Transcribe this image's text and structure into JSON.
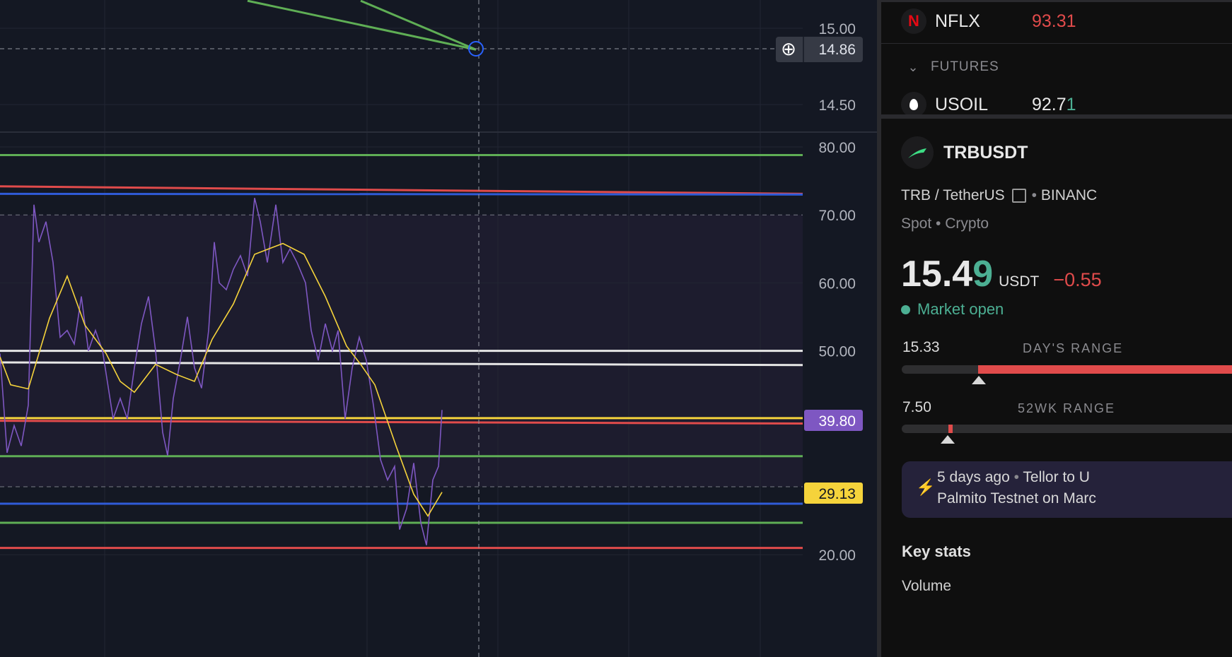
{
  "watchlist": {
    "items": [
      {
        "symbol": "NFLX",
        "price": "93.31",
        "logo": "N"
      }
    ],
    "section": "FUTURES",
    "futures": [
      {
        "symbol": "USOIL",
        "price_main": "92.7",
        "price_tick": "1"
      }
    ]
  },
  "symbol": {
    "ticker": "TRBUSDT",
    "description": "TRB / TetherUS",
    "exchange": "BINANC",
    "type": "Spot",
    "category": "Crypto",
    "price_main": "15.4",
    "price_tick": "9",
    "currency": "USDT",
    "change": "−0.55",
    "status": "Market open",
    "day_low": "15.33",
    "day_label": "DAY'S RANGE",
    "wk_low": "7.50",
    "wk_label": "52WK RANGE",
    "news_time": "5 days ago",
    "news_line1": "Tellor to U",
    "news_line2": "Palmito Testnet on Marc",
    "key_stats": "Key stats",
    "volume": "Volume"
  },
  "colors": {
    "up": "#4caf93",
    "down": "#e04b4b",
    "rsi": "#7e57c2",
    "ma": "#f5d33b"
  },
  "chart_data": [
    {
      "type": "line",
      "pane": "price",
      "yticks": [
        "15.00",
        "14.50"
      ],
      "ylim": [
        14.36,
        15.18
      ],
      "crosshair_label": "14.86",
      "lines": [
        {
          "color": "#5fae55",
          "x": [
            350,
            673
          ],
          "y": [
            15.18,
            14.86
          ]
        },
        {
          "color": "#5fae55",
          "x": [
            510,
            673
          ],
          "y": [
            15.18,
            14.86
          ]
        }
      ]
    },
    {
      "type": "line",
      "pane": "rsi",
      "ylim": [
        15.4,
        82
      ],
      "yticks": [
        "80.00",
        "70.00",
        "60.00",
        "50.00",
        "20.00"
      ],
      "rsi_label": "39.80",
      "ma_label": "29.13",
      "rsi": {
        "x": [
          0,
          10,
          20,
          30,
          40,
          48,
          55,
          65,
          75,
          85,
          95,
          105,
          115,
          125,
          135,
          145,
          160,
          170,
          180,
          190,
          200,
          210,
          220,
          230,
          237,
          245,
          255,
          265,
          275,
          285,
          295,
          303,
          310,
          320,
          330,
          340,
          350,
          360,
          368,
          378,
          390,
          400,
          410,
          420,
          432,
          440,
          450,
          460,
          470,
          478,
          488,
          498,
          508,
          518,
          528,
          538,
          548,
          558,
          565,
          575,
          585,
          595,
          603,
          612,
          620,
          625
        ],
        "y": [
          49.6,
          35,
          39,
          36,
          42,
          71.5,
          66,
          69,
          63,
          52,
          53,
          51,
          58,
          50,
          53,
          50,
          40,
          43,
          40,
          47.5,
          54,
          58,
          50,
          38,
          34.6,
          43,
          48.6,
          55,
          47.5,
          44.5,
          53,
          66,
          60,
          59,
          62,
          64,
          61,
          72.5,
          69,
          63,
          71.5,
          63,
          65,
          63,
          60,
          53,
          48.6,
          54,
          50,
          53,
          40,
          47.5,
          52,
          48.6,
          42,
          34,
          31,
          33,
          23.7,
          26.8,
          33.5,
          24.7,
          21.4,
          31,
          33,
          41.3
        ]
      },
      "ma": {
        "x": [
          0,
          15,
          40,
          70,
          95,
          120,
          150,
          170,
          190,
          220,
          250,
          275,
          300,
          330,
          360,
          400,
          430,
          460,
          490,
          510,
          530,
          560,
          585,
          605,
          625
        ],
        "y": [
          49.1,
          45,
          44.4,
          54.8,
          61,
          53.8,
          49.6,
          45.5,
          43.9,
          48,
          46.5,
          45.5,
          51.7,
          56.9,
          64.2,
          65.8,
          64.2,
          58,
          50.7,
          48,
          45,
          36,
          28.9,
          25.7,
          29.2
        ]
      },
      "hlines": [
        {
          "color": "#5fae55",
          "y": [
            78.8,
            78.8
          ]
        },
        {
          "color": "#e04b4b",
          "y": [
            74.2,
            73.1
          ]
        },
        {
          "color": "#2f5bd8",
          "y": [
            73.1,
            73.0
          ]
        },
        {
          "color": "#e6e6e6",
          "y": [
            50,
            50
          ]
        },
        {
          "color": "#e6e6e6",
          "y": [
            48.3,
            47.9
          ]
        },
        {
          "color": "#f5d33b",
          "y": [
            40.1,
            40.1
          ]
        },
        {
          "color": "#e04b4b",
          "y": [
            39.7,
            39.3
          ]
        },
        {
          "color": "#5fae55",
          "y": [
            34.5,
            34.5
          ]
        },
        {
          "color": "#2f5bd8",
          "y": [
            27.5,
            27.5
          ]
        },
        {
          "color": "#5fae55",
          "y": [
            24.7,
            24.7
          ]
        },
        {
          "color": "#e04b4b",
          "y": [
            21,
            21
          ]
        }
      ],
      "bands": [
        70,
        30
      ]
    }
  ]
}
